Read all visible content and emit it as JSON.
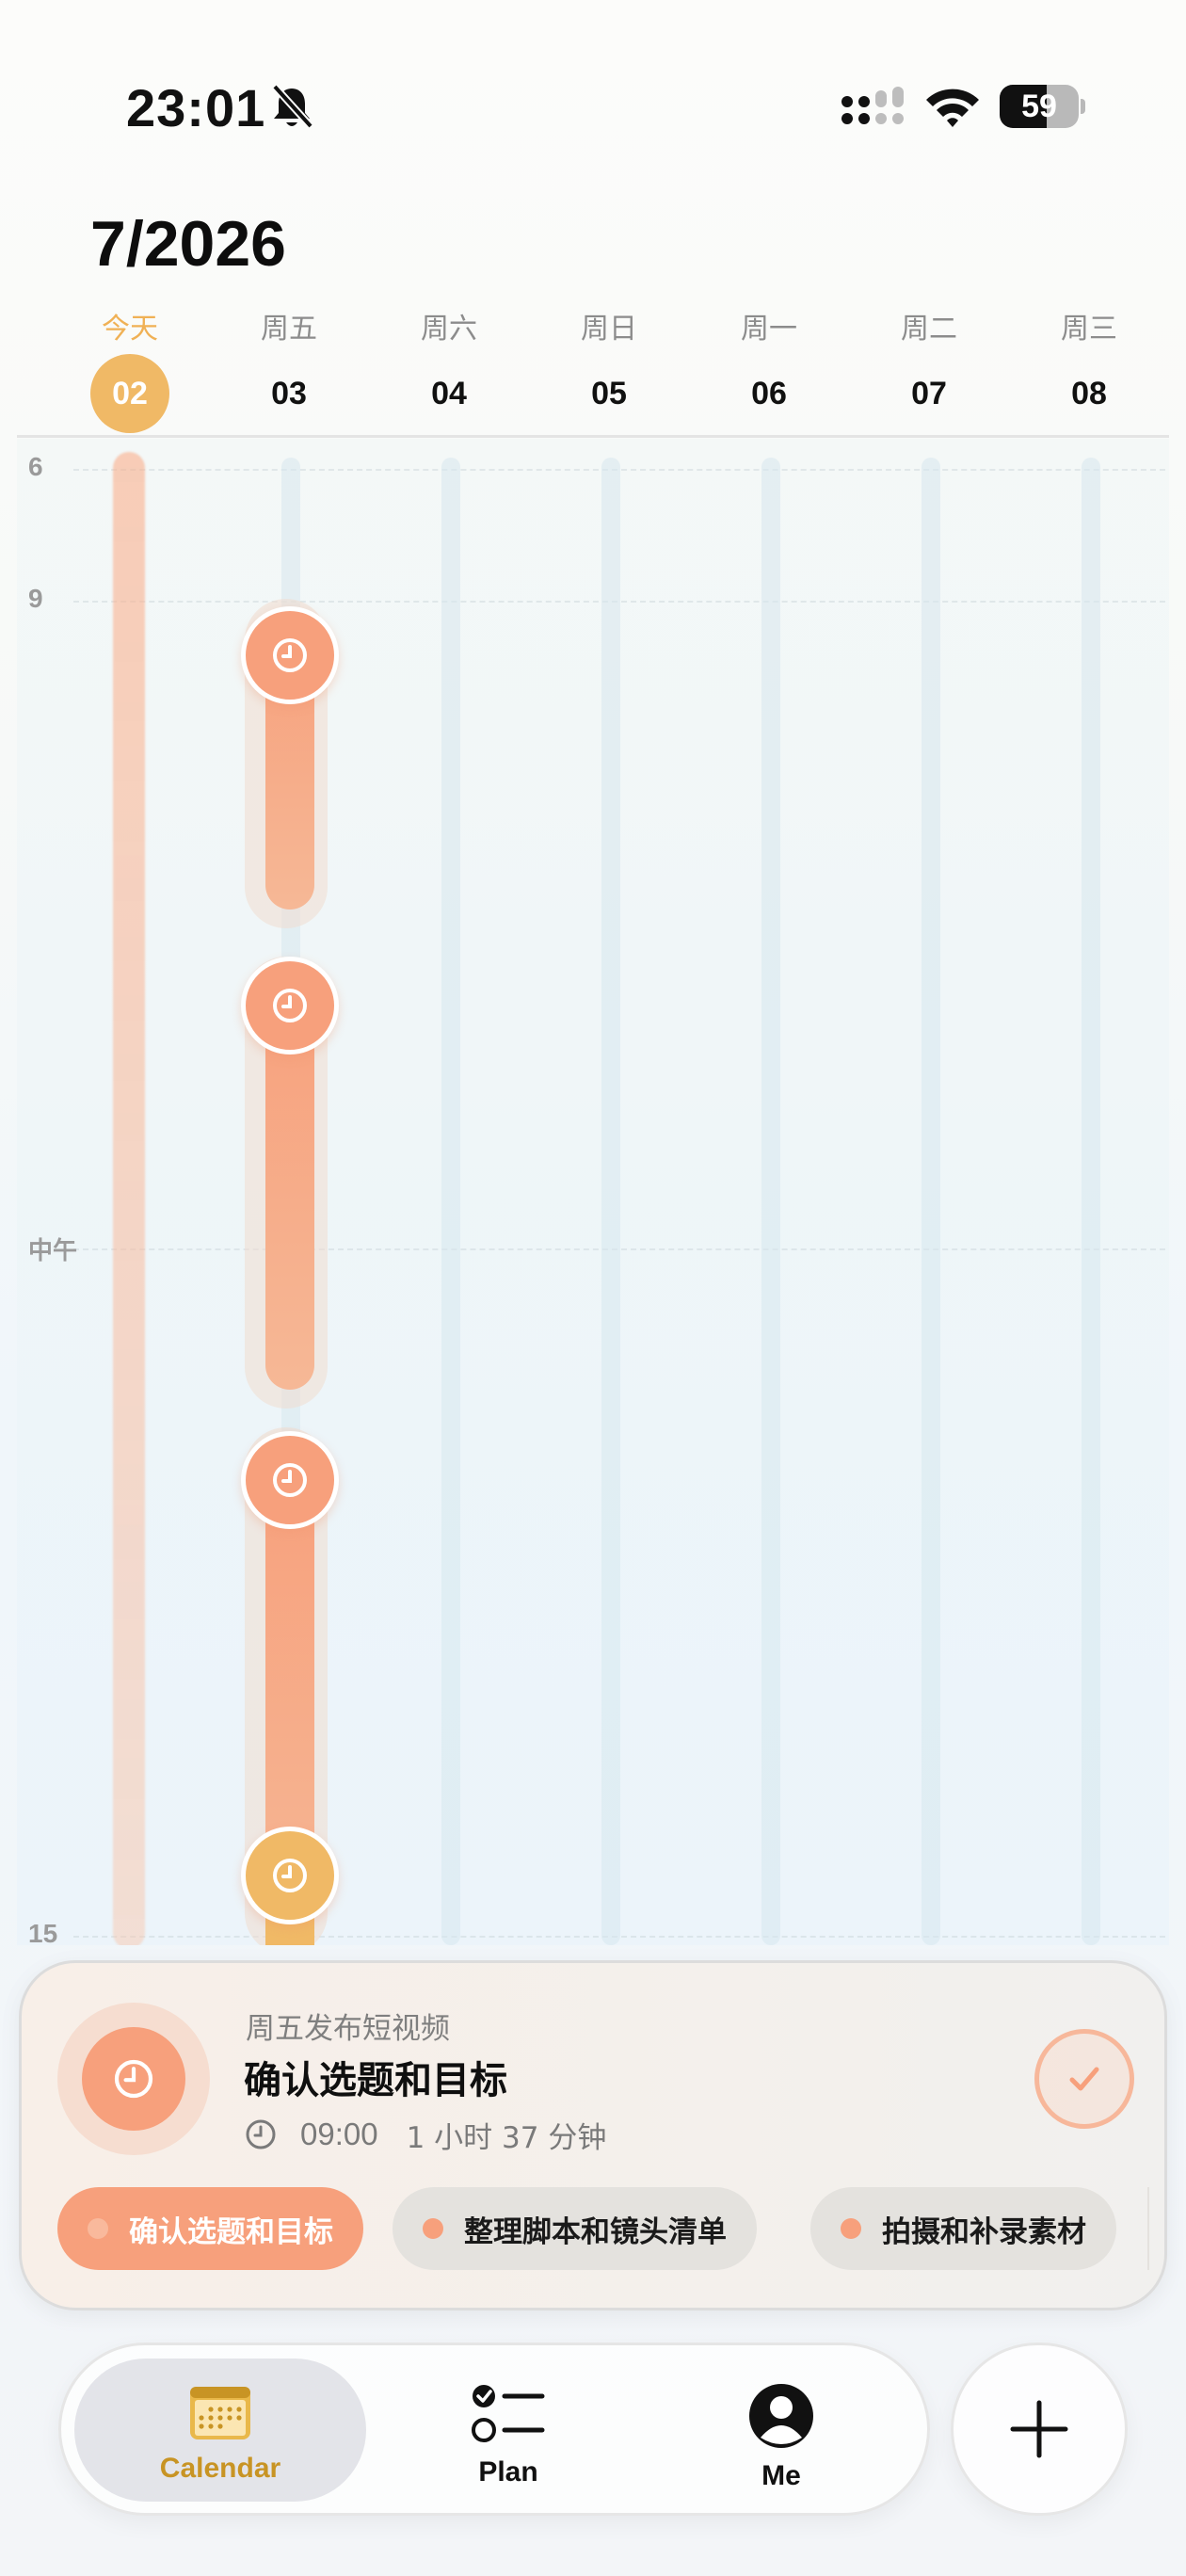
{
  "status_bar": {
    "time": "23:01",
    "battery_percent": "59",
    "battery_level": 0.59,
    "silent_icon": "bell-slash-icon",
    "signal_icon": "cellular-signal-icon",
    "wifi_icon": "wifi-icon"
  },
  "header": {
    "title": "7/2026"
  },
  "week": {
    "days": [
      {
        "label": "今天",
        "date": "02",
        "today": true
      },
      {
        "label": "周五",
        "date": "03"
      },
      {
        "label": "周六",
        "date": "04"
      },
      {
        "label": "周日",
        "date": "05"
      },
      {
        "label": "周一",
        "date": "06"
      },
      {
        "label": "周二",
        "date": "07"
      },
      {
        "label": "周三",
        "date": "08"
      }
    ]
  },
  "timeline": {
    "hour_labels": [
      "6",
      "9",
      "中午",
      "15"
    ],
    "events_day": "周五",
    "event_icon": "clock-icon"
  },
  "detail": {
    "subtitle": "周五发布短视频",
    "title": "确认选题和目标",
    "start_time": "09:00",
    "duration": "1 小时 37 分钟",
    "icon": "clock-icon",
    "complete_icon": "checkmark-icon"
  },
  "chips": [
    {
      "label": "确认选题和目标",
      "active": true
    },
    {
      "label": "整理脚本和镜头清单"
    },
    {
      "label": "拍摄和补录素材"
    }
  ],
  "tab_bar": {
    "tabs": [
      {
        "label": "Calendar",
        "icon": "calendar-icon",
        "active": true
      },
      {
        "label": "Plan",
        "icon": "checklist-icon"
      },
      {
        "label": "Me",
        "icon": "person-icon"
      }
    ],
    "add_icon": "plus-icon"
  },
  "colors": {
    "accent_orange": "#f7a07c",
    "accent_yellow": "#f0b966",
    "tab_active_text": "#c89424"
  }
}
